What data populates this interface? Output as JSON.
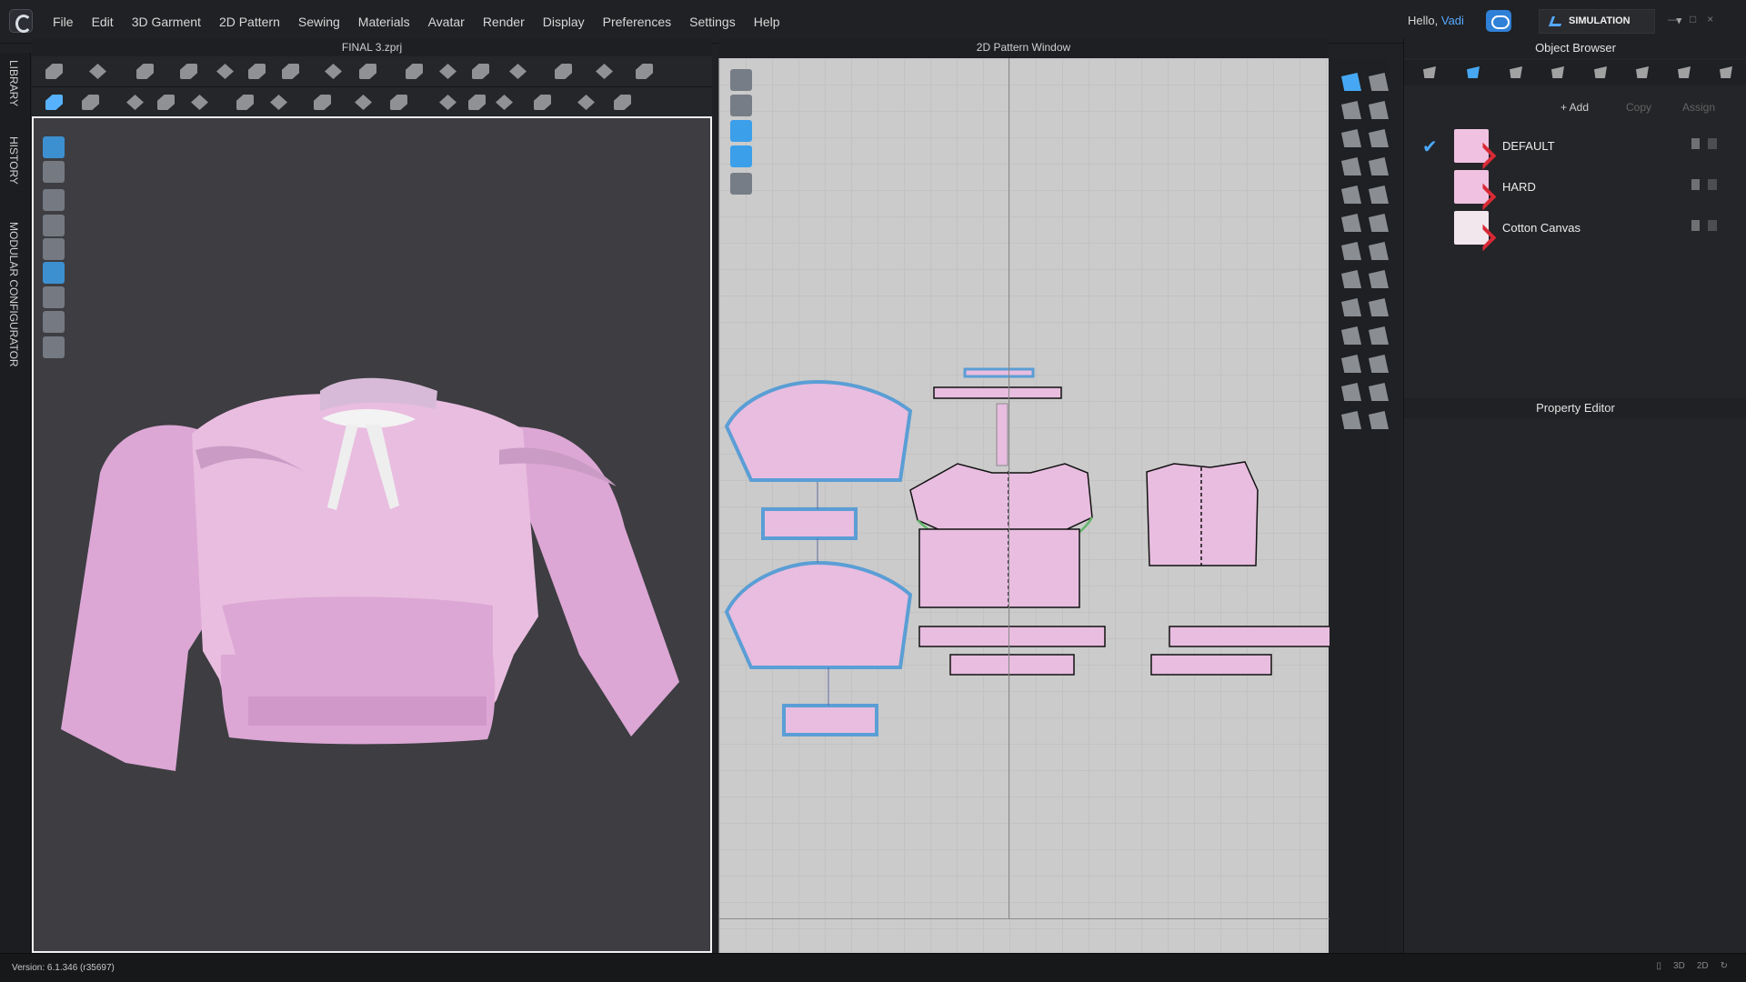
{
  "app": {
    "project_title": "FINAL 3.zprj",
    "pattern_window_title": "2D Pattern Window",
    "greeting_prefix": "Hello, ",
    "user_name": "Vadi",
    "mode": "SIMULATION",
    "version": "Version: 6.1.346 (r35697)"
  },
  "menu": [
    "File",
    "Edit",
    "3D Garment",
    "2D Pattern",
    "Sewing",
    "Materials",
    "Avatar",
    "Render",
    "Display",
    "Preferences",
    "Settings",
    "Help"
  ],
  "left_tabs": [
    "LIBRARY",
    "HISTORY",
    "MODULAR CONFIGURATOR"
  ],
  "object_browser": {
    "title": "Object Browser",
    "add_label": "+ Add",
    "copy_label": "Copy",
    "assign_label": "Assign",
    "materials": [
      "DEFAULT",
      "HARD",
      "Cotton Canvas"
    ]
  },
  "property_editor": {
    "title": "Property Editor"
  },
  "status_buttons": [
    "▯",
    "3D",
    "2D",
    "↻"
  ],
  "colors": {
    "accent": "#3b9fea",
    "fabric": "#e9bde0",
    "background": "#3d3d42",
    "pattern_grid": "#cbcbcb"
  }
}
